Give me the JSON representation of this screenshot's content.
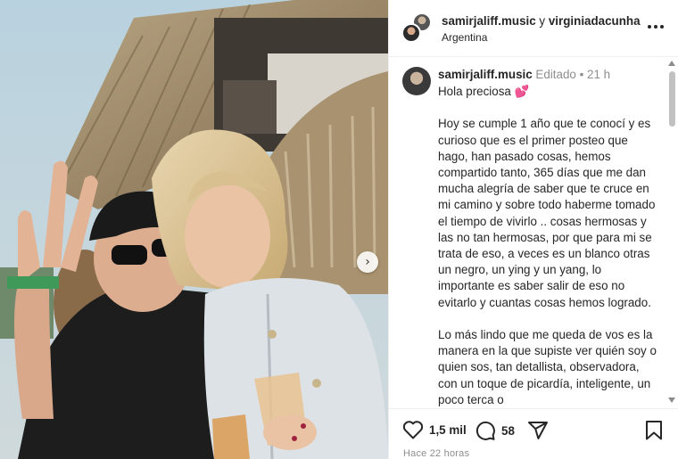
{
  "header": {
    "user1": "samirjaliff.music",
    "connector": "y",
    "user2": "virginiadacunha",
    "location": "Argentina",
    "more_icon": "more-horizontal-icon"
  },
  "caption": {
    "username": "samirjaliff.music",
    "edited": "Editado",
    "separator": "•",
    "time": "21 h",
    "greeting": "Hola preciosa",
    "emoji": "💕",
    "paragraph1": "Hoy se cumple 1 año que te conocí y es curioso que es el primer posteo que hago, han pasado cosas, hemos compartido tanto, 365 días que me dan mucha alegría de saber que te cruce en mi camino y sobre todo haberme tomado el tiempo de vivirlo .. cosas hermosas y las no tan hermosas, por que para mi se trata de eso, a veces es un blanco otras un negro, un ying y un yang, lo importante es saber salir de eso no evitarlo y cuantas cosas hemos logrado.",
    "paragraph2": "Lo más lindo que me queda de vos es la manera en la que supiste ver quién soy o quien sos, tan detallista, observadora, con un toque de picardía, inteligente, un poco terca o"
  },
  "actions": {
    "likes": "1,5 mil",
    "comments": "58",
    "posted": "Hace 22 horas",
    "icons": [
      "heart-icon",
      "comment-icon",
      "share-icon",
      "bookmark-icon"
    ]
  },
  "photo": {
    "next_icon": "chevron-right-icon"
  },
  "colors": {
    "text": "#262626",
    "muted": "#8e8e8e",
    "divider": "#efefef",
    "emoji_pink": "#e94a8a"
  }
}
